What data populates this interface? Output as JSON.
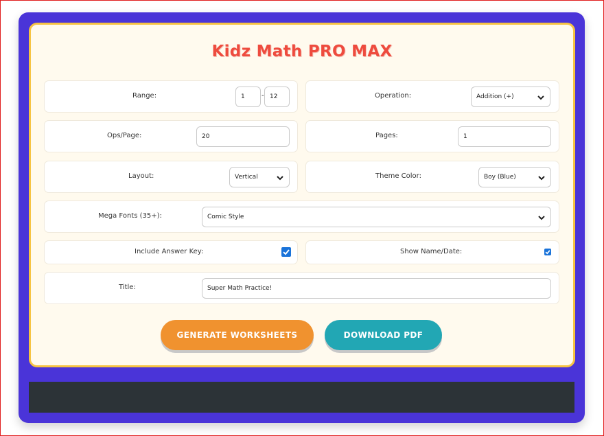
{
  "app_title": "Kidz Math PRO MAX",
  "form": {
    "range": {
      "label": "Range:",
      "min": "1",
      "separator": "-",
      "max": "12"
    },
    "operation": {
      "label": "Operation:",
      "value": "Addition (+)"
    },
    "ops_per_page": {
      "label": "Ops/Page:",
      "value": "20"
    },
    "pages": {
      "label": "Pages:",
      "value": "1"
    },
    "layout": {
      "label": "Layout:",
      "value": "Vertical"
    },
    "theme_color": {
      "label": "Theme Color:",
      "value": "Boy (Blue)"
    },
    "mega_fonts": {
      "label": "Mega Fonts (35+):",
      "value": "Comic Style"
    },
    "answer_key": {
      "label": "Include Answer Key:",
      "checked": true
    },
    "name_date": {
      "label": "Show Name/Date:",
      "checked": true
    },
    "title": {
      "label": "Title:",
      "value": "Super Math Practice!"
    }
  },
  "buttons": {
    "generate": "GENERATE WORKSHEETS",
    "download": "DOWNLOAD PDF"
  },
  "colors": {
    "shell": "#4a34d8",
    "card_border": "#f6c343",
    "title": "#ee4b3e",
    "generate_button": "#f0922f",
    "download_button": "#22a7b4",
    "checkbox": "#1a73d9",
    "footer": "#2c3337"
  },
  "icons": [
    "chevron-down-icon",
    "checkmark-icon"
  ]
}
